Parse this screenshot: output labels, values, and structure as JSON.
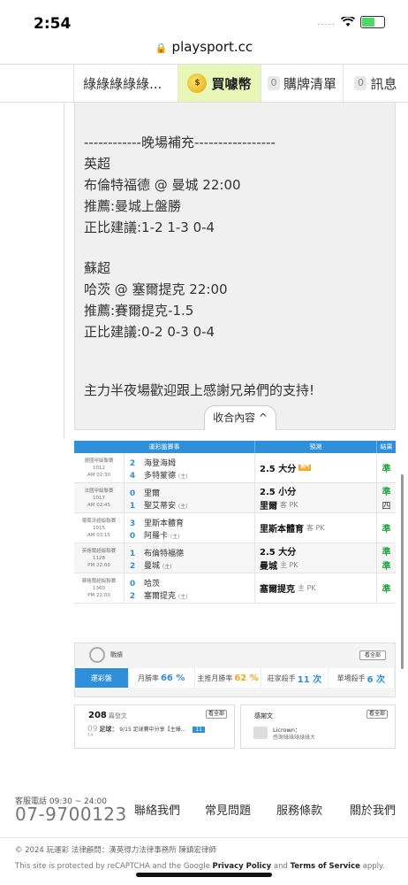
{
  "status": {
    "time": "2:54",
    "signal": "....."
  },
  "url": "playsport.cc",
  "nav": {
    "user": "綠綠綠綠綠...",
    "buy": "買噱幣",
    "cart_count": "0",
    "cart": "購牌清單",
    "msg_count": "0",
    "msg": "訊息"
  },
  "article": {
    "lines": [
      "------------晚場補充-----------------",
      "英超",
      "布倫特福德 @ 曼城 22:00",
      "推薦:曼城上盤勝",
      "正比建議:1-2 1-3 0-4",
      "",
      "蘇超",
      "哈茨 @ 塞爾提克 22:00",
      "推薦:賽爾提克-1.5",
      "正比建議:0-2 0-3 0-4",
      "",
      "主力半夜場歡迎跟上感謝兄弟們的支持!"
    ],
    "collapse": "收合內容 ^"
  },
  "table": {
    "headers": [
      "運彩盤賽事",
      "預測",
      "結果"
    ],
    "rows": [
      {
        "league": "德國甲級聯賽",
        "no": "1012",
        "time": "AM 02:30",
        "away_score": "2",
        "away": "海登海姆",
        "home_score": "4",
        "home": "多特蒙德",
        "home_mark": "(主)",
        "preds": [
          {
            "text": "2.5 大分",
            "sub": "",
            "hot": "熱門",
            "res": "準"
          }
        ]
      },
      {
        "league": "法國甲級聯賽",
        "no": "1017",
        "time": "AM 02:45",
        "away_score": "0",
        "away": "里爾",
        "home_score": "1",
        "home": "聖艾蒂安",
        "home_mark": "(主)",
        "preds": [
          {
            "text": "2.5 小分",
            "sub": "",
            "hot": "",
            "res": "準"
          },
          {
            "text": "里爾",
            "sub": "客 PK",
            "hot": "",
            "res": "四"
          }
        ]
      },
      {
        "league": "葡萄牙超級聯賽",
        "no": "1015",
        "time": "AM 03:15",
        "away_score": "3",
        "away": "里斯本體育",
        "home_score": "0",
        "home": "阿羅卡",
        "home_mark": "(主)",
        "preds": [
          {
            "text": "里斯本體育",
            "sub": "客 PK",
            "hot": "",
            "res": "準"
          }
        ]
      },
      {
        "league": "英格蘭超級聯賽",
        "no": "1128",
        "time": "PM 22:00",
        "away_score": "1",
        "away": "布倫特福德",
        "home_score": "2",
        "home": "曼城",
        "home_mark": "(主)",
        "preds": [
          {
            "text": "2.5 大分",
            "sub": "",
            "hot": "",
            "res": "準"
          },
          {
            "text": "曼城",
            "sub": "主 PK",
            "hot": "",
            "res": "準"
          }
        ]
      },
      {
        "league": "蘇格蘭超級聯賽",
        "no": "1360",
        "time": "PM 22:00",
        "away_score": "0",
        "away": "哈茨",
        "home_score": "2",
        "home": "塞爾提克",
        "home_mark": "(主)",
        "preds": [
          {
            "text": "塞爾提克",
            "sub": "主 PK",
            "hot": "",
            "res": "準"
          }
        ]
      }
    ]
  },
  "rank": {
    "title": "戰績",
    "all": "看全部",
    "tabs": [
      {
        "label": "運彩盤",
        "value": ""
      },
      {
        "label": "月勝率",
        "value": "66 %"
      },
      {
        "label": "主推月勝率",
        "value": "62 %"
      },
      {
        "label": "莊家殺手",
        "value": "11 次"
      },
      {
        "label": "單場殺手",
        "value": "6 次"
      }
    ]
  },
  "cards": {
    "a_count": "208",
    "a_title": "篇發文",
    "a_all": "看全部",
    "a_date": "09",
    "a_month": "14",
    "a_cat": "足球：",
    "a_text": "9/15 足球賽中分享【主爆...",
    "a_badge": "11",
    "b_title": "感謝文",
    "b_all": "看全部",
    "b_user": "Licrown：",
    "b_text": "感謝綠綠綠綠綠大"
  },
  "footer": {
    "hotline_label": "客服電話 09:30 ~ 24:00",
    "hotline": "07-9700123",
    "links": [
      "聯絡我們",
      "常見問題",
      "服務條款",
      "關於我們"
    ],
    "copyright": "© 2024 玩運彩 法律顧問：漢英得力法律事務所 陳鎮宏律師",
    "captcha_a": "This site is protected by reCAPTCHA and the Google ",
    "privacy": "Privacy Policy",
    "and": " and ",
    "terms": "Terms of Service",
    "apply": " apply."
  }
}
